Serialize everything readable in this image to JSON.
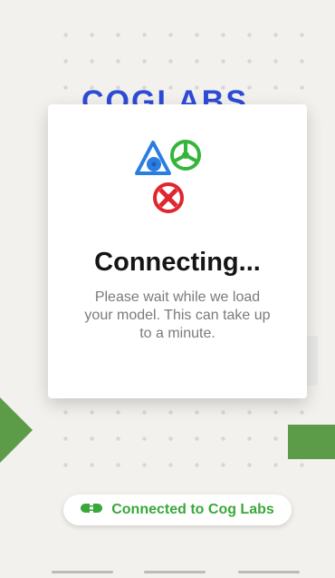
{
  "background": {
    "brand_peek_text": "COGLABS",
    "brand_color": "#2e4bd6"
  },
  "modal": {
    "title": "Connecting...",
    "message": "Please wait while we load your model. This can take up to a minute.",
    "icons": [
      "blue-triangle-wheel-icon",
      "green-wheel-icon",
      "red-wheel-icon"
    ],
    "colors": {
      "blue": "#2a7de1",
      "green": "#35b53a",
      "red": "#e0262e"
    }
  },
  "status": {
    "text": "Connected to Cog Labs",
    "icon": "plug-icon",
    "color": "#39a83a"
  },
  "decor": {
    "arrow_color": "#5c9c48"
  }
}
